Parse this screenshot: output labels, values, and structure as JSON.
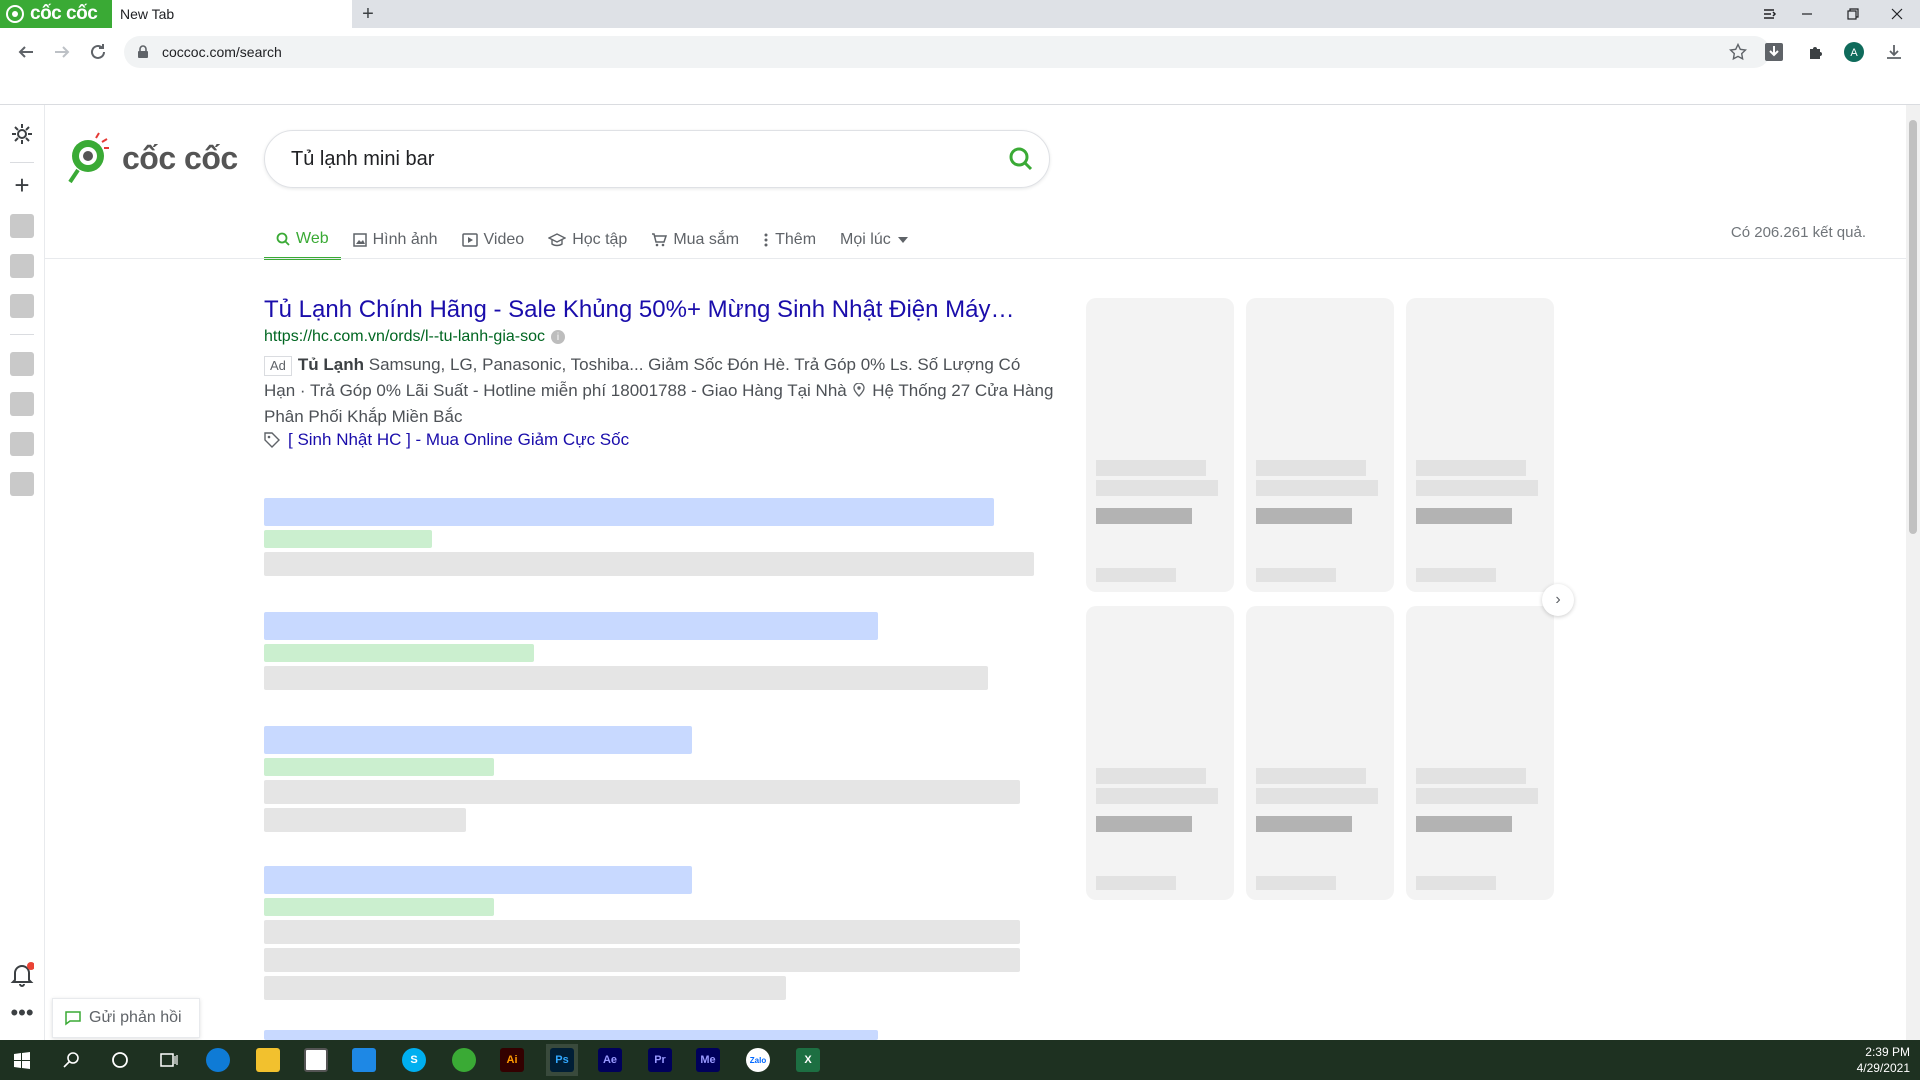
{
  "browser": {
    "brand_tab_label": "cốc cốc",
    "active_tab_title": "New Tab",
    "address": "coccoc.com/search"
  },
  "search": {
    "query": "Tủ lạnh mini bar",
    "logo_text": "cốc cốc"
  },
  "nav_tabs": [
    {
      "label": "Web",
      "icon": "search-icon"
    },
    {
      "label": "Hình ảnh",
      "icon": "image-icon"
    },
    {
      "label": "Video",
      "icon": "video-icon"
    },
    {
      "label": "Học tập",
      "icon": "graduation-cap-icon"
    },
    {
      "label": "Mua sắm",
      "icon": "cart-icon"
    },
    {
      "label": "Thêm",
      "icon": "more-vertical-icon"
    },
    {
      "label": "Mọi lúc",
      "icon": "caret-down-icon"
    }
  ],
  "result_count": "Có 206.261 kết quả.",
  "ad": {
    "title": "Tủ Lạnh Chính Hãng - Sale Khủng 50%+ Mừng Sinh Nhật Điện Máy…",
    "url": "https://hc.com.vn/ords/l--tu-lanh-gia-soc",
    "badge": "Ad",
    "desc_bold": "Tủ Lạnh",
    "desc_rest": " Samsung, LG, Panasonic, Toshiba... Giảm Sốc Đón Hè. Trả Góp 0% Ls. Số Lượng Có Hạn · Trả Góp 0% Lãi Suất - Hotline miễn phí 18001788 - Giao Hàng Tại Nhà",
    "desc_location": "Hệ Thống 27 Cửa Hàng Phân Phối Khắp Miền Bắc",
    "sitelink": "[ Sinh Nhật HC ] - Mua Online Giảm Cực Sốc"
  },
  "feedback_label": "Gửi phản hồi",
  "clock": {
    "time": "2:39 PM",
    "date": "4/29/2021"
  },
  "taskbar_apps": [
    {
      "name": "edge",
      "label": "",
      "color": "#0f7bd6"
    },
    {
      "name": "file-explorer",
      "label": "",
      "color": "#f2c12e"
    },
    {
      "name": "store",
      "label": "",
      "color": "#ffffff"
    },
    {
      "name": "mail",
      "label": "",
      "color": "#1e88e5"
    },
    {
      "name": "skype",
      "label": "S",
      "color": "#00aff0"
    },
    {
      "name": "coccoc",
      "label": "",
      "color": "#3aaa35"
    },
    {
      "name": "illustrator",
      "label": "Ai",
      "color": "#330000"
    },
    {
      "name": "photoshop",
      "label": "Ps",
      "color": "#001e36"
    },
    {
      "name": "after-effects",
      "label": "Ae",
      "color": "#00005b"
    },
    {
      "name": "premiere",
      "label": "Pr",
      "color": "#00005b"
    },
    {
      "name": "media-encoder",
      "label": "Me",
      "color": "#00005b"
    },
    {
      "name": "zalo",
      "label": "Zalo",
      "color": "#0068ff"
    },
    {
      "name": "excel",
      "label": "X",
      "color": "#1d6f42"
    }
  ],
  "colors": {
    "accent": "#3aaa35",
    "link": "#1a0dab",
    "url": "#006621"
  }
}
